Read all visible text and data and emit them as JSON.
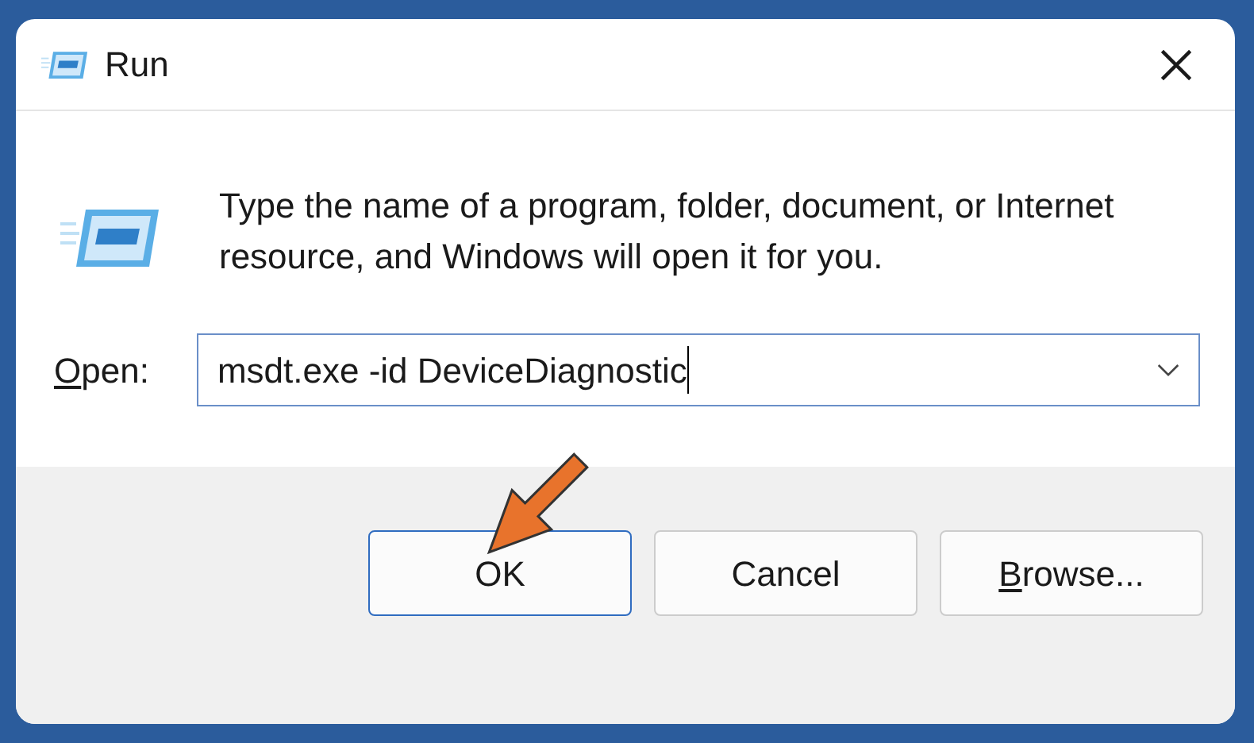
{
  "window": {
    "title": "Run"
  },
  "description": "Type the name of a program, folder, document, or Internet resource, and Windows will open it for you.",
  "open_field": {
    "label": "Open:",
    "label_access_key_underlined": true,
    "value": "msdt.exe -id DeviceDiagnostic",
    "focused": true
  },
  "buttons": [
    {
      "label": "OK",
      "default": true,
      "access_key_underlined": false
    },
    {
      "label": "Cancel",
      "default": false,
      "access_key_underlined": false
    },
    {
      "label": "Browse...",
      "default": false,
      "access_key_underlined": true
    }
  ],
  "annotation": {
    "kind": "arrow"
  }
}
